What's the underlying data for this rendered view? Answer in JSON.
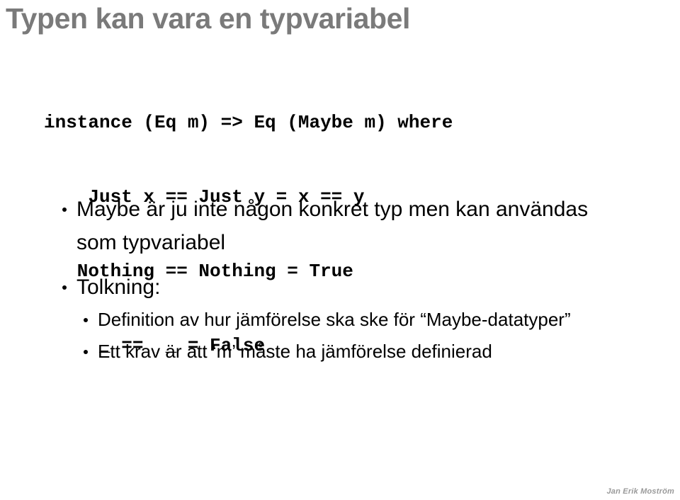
{
  "slide": {
    "title": "Typen kan vara en typvariabel",
    "background_color": "#ffffff",
    "title_color": "#7a7a7a",
    "body_color": "#000000"
  },
  "code": {
    "language": "haskell",
    "lines": [
      "instance (Eq m) => Eq (Maybe m) where",
      "    Just x == Just y = x == y",
      "   Nothing == Nothing = True",
      "     _ ==  _ = False"
    ]
  },
  "bullets": [
    {
      "level": 1,
      "text": "Maybe är ju inte någon konkret typ men kan användas som typvariabel"
    },
    {
      "level": 1,
      "text": "Tolkning:"
    },
    {
      "level": 2,
      "text": "Definition av hur jämförelse ska ske för “Maybe-datatyper”"
    },
    {
      "level": 2,
      "text": "Ett krav är att ‘m’ måste ha jämförelse definierad"
    }
  ],
  "footer": {
    "signature": "Jan Erik Moström",
    "color": "#9a9a9a"
  }
}
